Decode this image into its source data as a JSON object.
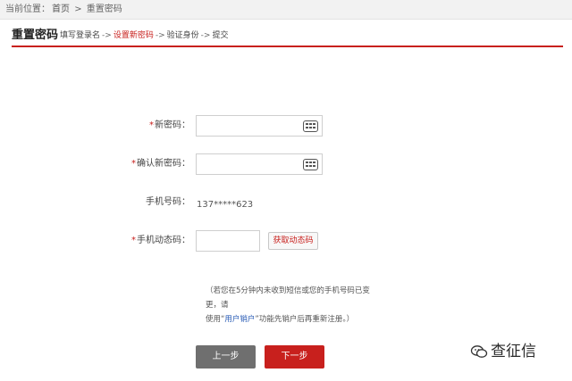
{
  "breadcrumb": {
    "prefix": "当前位置：",
    "home": "首页",
    "sep": ">",
    "current": "重置密码"
  },
  "header": {
    "title": "重置密码",
    "steps": [
      {
        "label": "填写登录名",
        "active": false
      },
      {
        "label": "设置新密码",
        "active": true
      },
      {
        "label": "验证身份",
        "active": false
      },
      {
        "label": "提交",
        "active": false
      }
    ],
    "arrow": "->"
  },
  "form": {
    "star": "*",
    "new_password_label": "新密码：",
    "new_password_value": "",
    "confirm_password_label": "确认新密码：",
    "confirm_password_value": "",
    "phone_label": "手机号码：",
    "phone_value": "137*****623",
    "sms_code_label": "手机动态码：",
    "sms_code_value": "",
    "sms_button": "获取动态码"
  },
  "notice": {
    "line1": "（若您在5分钟内未收到短信或您的手机号码已变更，请",
    "line2_pre": "使用“",
    "line2_link": "用户销户",
    "line2_post": "”功能先销户后再重新注册。）"
  },
  "buttons": {
    "prev": "上一步",
    "next": "下一步"
  },
  "watermark": {
    "text": "查征信",
    "icon": "wechat-icon"
  },
  "colors": {
    "accent": "#c8201d",
    "link": "#2b5db6",
    "prev_button": "#6f6f6f"
  }
}
